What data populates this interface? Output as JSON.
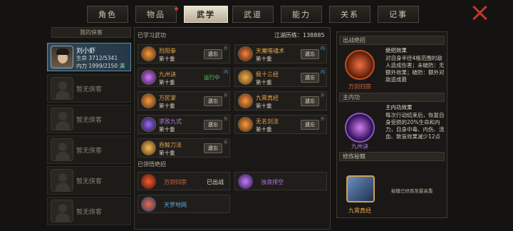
{
  "tabs": [
    {
      "label": "角色"
    },
    {
      "label": "物品"
    },
    {
      "label": "武学"
    },
    {
      "label": "武道"
    },
    {
      "label": "能力"
    },
    {
      "label": "关系"
    },
    {
      "label": "记事"
    }
  ],
  "left": {
    "header": "我的侠客",
    "hero": {
      "name": "刘小虾",
      "hp_label": "生命",
      "hp": "3712/5341",
      "mp_label": "内力",
      "mp": "1999/2150",
      "tag": "满"
    },
    "empty_slots": [
      "暂无侠客",
      "暂无侠客",
      "暂无侠客",
      "暂无侠客",
      "暂无侠客",
      "暂无侠客"
    ]
  },
  "center": {
    "learned_title": "已学习武功",
    "exp_label": "江湖历练：",
    "exp_value": "138885",
    "skills": [
      {
        "name": "烈阳拳",
        "level": "第十重",
        "action": "遗忘",
        "tag": "外",
        "tag_color": "grey",
        "name_color": "orange"
      },
      {
        "name": "天魔噬魂术",
        "level": "第十重",
        "action": "遗忘",
        "tag": "内",
        "tag_color": "blue",
        "name_color": "orange"
      },
      {
        "name": "九州诀",
        "level": "第十重",
        "action": "运行中",
        "tag": "内",
        "tag_color": "blue",
        "name_color": "orange"
      },
      {
        "name": "佩十三经",
        "level": "第十重",
        "action": "遗忘",
        "tag": "内",
        "tag_color": "blue",
        "name_color": "orange"
      },
      {
        "name": "万民掌",
        "level": "第十重",
        "action": "遗忘",
        "tag": "外",
        "tag_color": "grey",
        "name_color": "orange"
      },
      {
        "name": "九霄真经",
        "level": "第十重",
        "action": "遗忘",
        "tag": "外",
        "tag_color": "grey",
        "name_color": "orange"
      },
      {
        "name": "求败九式",
        "level": "第十重",
        "action": "遗忘",
        "tag": "外",
        "tag_color": "grey",
        "name_color": "purple"
      },
      {
        "name": "无名剑法",
        "level": "第十重",
        "action": "遗忘",
        "tag": "外",
        "tag_color": "grey",
        "name_color": "orange"
      },
      {
        "name": "吞鲸刀法",
        "level": "第十重",
        "action": "遗忘",
        "tag": "外",
        "tag_color": "grey",
        "name_color": "orange"
      }
    ],
    "ult_title": "已领悟绝招",
    "ults": [
      {
        "name": "万剑归宗",
        "status": "已出战",
        "color": "#e06a3a"
      },
      {
        "name": "浊浪排空",
        "status": "",
        "color": "#b27ee6"
      },
      {
        "name": "天罗地网",
        "status": "",
        "color": "#5fa8e0"
      }
    ]
  },
  "right": {
    "ult_section": "出战绝招",
    "ult_name": "万剑归宗",
    "ult_effect_title": "绝招效果",
    "ult_effect_text": "对自身半径4格范围的敌人造成伤害；未破防：无额外效果；破防：额外对敌造成最",
    "inner_section": "主内功",
    "inner_name": "九州诀",
    "inner_effect_title": "主内功效果",
    "inner_effect_text": "每次行动结束后，恢复自身受损的20%生命和内力，自身中毒、内伤、流血、致盲效果减少12点",
    "cult_section": "修炼秘籍",
    "cult_name": "九霄真经",
    "cult_text": "秘籍已修炼至最高重"
  }
}
